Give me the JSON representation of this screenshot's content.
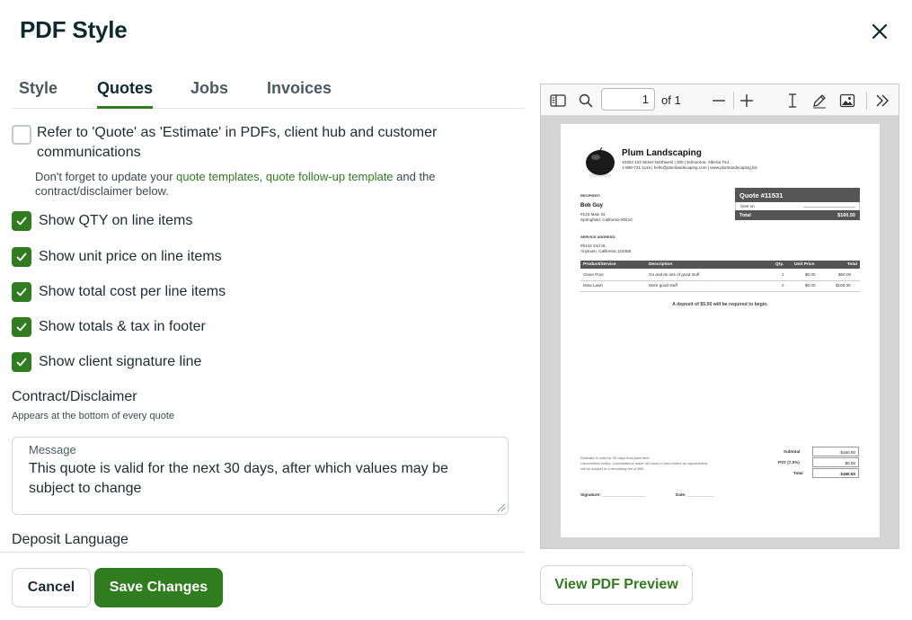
{
  "modal": {
    "title": "PDF Style",
    "close_icon": "close-icon"
  },
  "tabs": [
    {
      "label": "Style",
      "active": false
    },
    {
      "label": "Quotes",
      "active": true
    },
    {
      "label": "Jobs",
      "active": false
    },
    {
      "label": "Invoices",
      "active": false
    }
  ],
  "estimate_option": {
    "label_line1": "Refer to 'Quote' as 'Estimate' in PDFs, client hub and customer",
    "label_line2": "communications",
    "checked": false
  },
  "note": {
    "prefix": "Don't forget to update your ",
    "link1": "quote templates",
    "sep": ", ",
    "link2": "quote follow-up template",
    "suffix": " and the",
    "line2": "contract/disclaimer below."
  },
  "options": [
    {
      "label": "Show QTY on line items",
      "checked": true
    },
    {
      "label": "Show unit price on line items",
      "checked": true
    },
    {
      "label": "Show total cost per line items",
      "checked": true
    },
    {
      "label": "Show totals & tax in footer",
      "checked": true
    },
    {
      "label": "Show client signature line",
      "checked": true
    }
  ],
  "contract": {
    "title": "Contract/Disclaimer",
    "subtitle": "Appears at the bottom of every quote",
    "message_label": "Message",
    "message_value": "This quote is valid for the next 30 days, after which values may be subject to change"
  },
  "deposit": {
    "title": "Deposit Language"
  },
  "buttons": {
    "cancel": "Cancel",
    "save": "Save Changes",
    "view_preview": "View PDF Preview"
  },
  "viewer": {
    "page_number": "1",
    "page_of": "of 1",
    "icons": [
      "sidebar-toggle-icon",
      "search-icon",
      "zoom-out-icon",
      "zoom-in-icon",
      "text-cursor-icon",
      "draw-icon",
      "image-icon",
      "more-tools-icon"
    ]
  },
  "pdf": {
    "company": "Plum Landscaping",
    "address": "10303 103 Street Northwest  |  300  |  Edmonton, Alberta T5J",
    "contact": "1-888-721-1115  |  hello@plumlandscaping.com  |  www.plumlandscaping.biz",
    "recipient_label": "RECIPIENT:",
    "recipient_name": "Bob Guy",
    "recipient_addr1": "#123 Main St.",
    "recipient_addr2": "Springfield, California 90210",
    "service_label": "SERVICE ADDRESS:",
    "service_addr1": "#8142 2nd St.",
    "service_addr2": "Anytown, California 123456",
    "quote_title": "Quote #11531",
    "sent_on": "Sent on",
    "total_label": "Total",
    "total_value": "$160.50",
    "table_headers": [
      "Product/Service",
      "Description",
      "Qty.",
      "Unit Price",
      "Total"
    ],
    "rows": [
      {
        "product": "Clean Pool",
        "description": "Go and do lots of good stuff",
        "qty": "1",
        "unit": "$0.00",
        "total": "$50.00"
      },
      {
        "product": "Mow Lawn",
        "description": "More good stuff",
        "qty": "2",
        "unit": "$0.00",
        "total": "$100.00"
      }
    ],
    "deposit_note": "A deposit of $5.00 will be required to begin.",
    "footer_note1": "Estimate is valid for 30 days from date sent.",
    "footer_note2": "Cancellation policy: Cancellations made 48 hours or less before an appointment",
    "footer_note3": "will be subject to a rebooking fee of $50.",
    "subtotal_label": "Subtotal",
    "subtotal_value": "$150.00",
    "pst_label": "PST (7.0%)",
    "pst_value": "$0.00",
    "grand_total_label": "Total",
    "grand_total_value": "$160.50",
    "signature": "Signature: ___________________",
    "date": "Date: ____________"
  },
  "colors": {
    "brand_green": "#2f7d1f",
    "title_dark": "#0e2a2f"
  }
}
